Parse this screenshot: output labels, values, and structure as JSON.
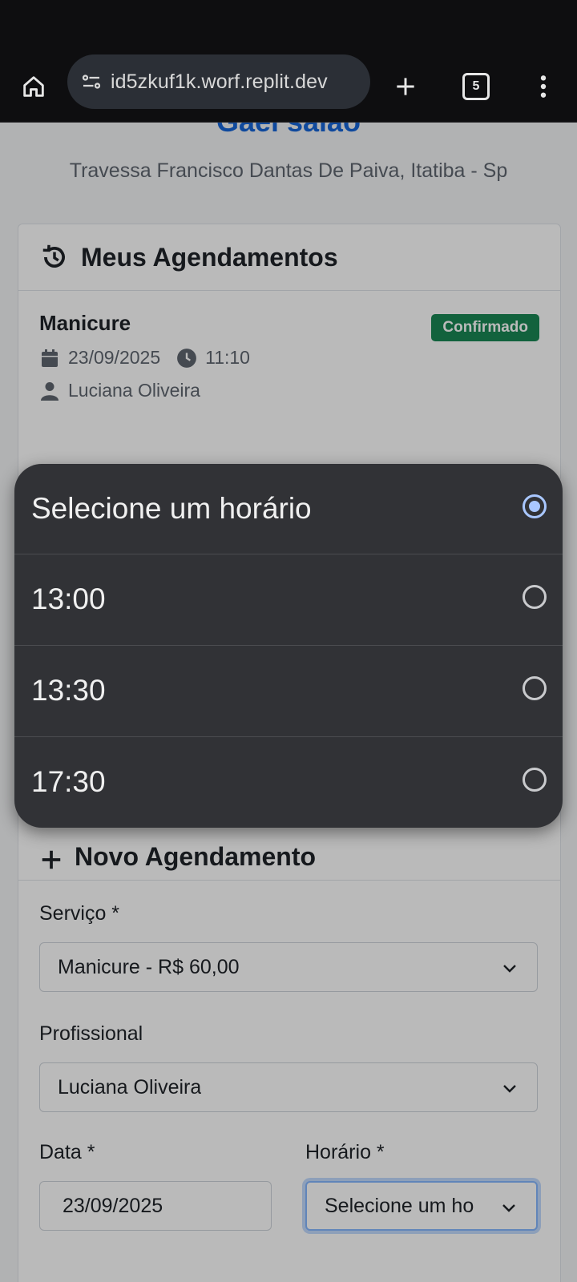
{
  "browser": {
    "url": "id5zkuf1k.worf.replit.dev",
    "tab_count": "5"
  },
  "header": {
    "title": "Gael salão",
    "address": "Travessa Francisco Dantas De Paiva, Itatiba - Sp"
  },
  "appointments": {
    "title": "Meus Agendamentos",
    "items": [
      {
        "service": "Manicure",
        "status": "Confirmado",
        "date": "23/09/2025",
        "time": "11:10",
        "professional": "Luciana Oliveira"
      }
    ]
  },
  "new_appointment": {
    "title": "Novo Agendamento",
    "service_label": "Serviço *",
    "service_value": "Manicure - R$ 60,00",
    "professional_label": "Profissional",
    "professional_value": "Luciana Oliveira",
    "date_label": "Data *",
    "date_value": "23/09/2025",
    "time_label": "Horário *",
    "time_value": "Selecione um ho"
  },
  "time_picker": {
    "options": [
      {
        "label": "Selecione um horário",
        "selected": true
      },
      {
        "label": "13:00",
        "selected": false
      },
      {
        "label": "13:30",
        "selected": false
      },
      {
        "label": "17:30",
        "selected": false
      }
    ]
  },
  "colors": {
    "accent": "#1565d8",
    "success": "#198754",
    "picker_bg": "#313236",
    "radio_selected": "#a9c7ff"
  }
}
